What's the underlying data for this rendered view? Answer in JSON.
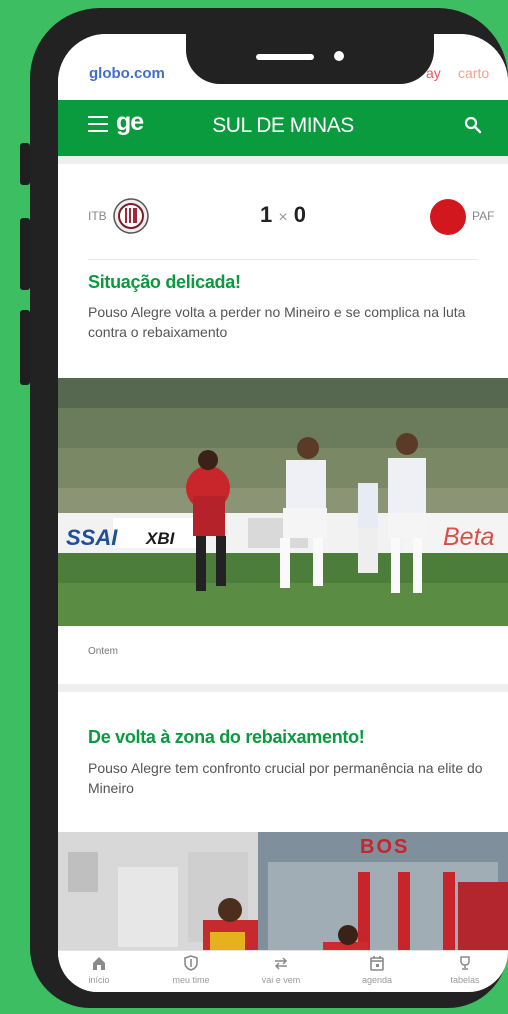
{
  "topbar": {
    "brand": "globo.com",
    "play": "ay",
    "cartola": "carto"
  },
  "header": {
    "logo": "ge",
    "section_title": "SUL DE MINAS"
  },
  "match": {
    "home_team": "ITB",
    "away_team": "PAF",
    "home_score": "1",
    "separator": "×",
    "away_score": "0"
  },
  "articles": [
    {
      "headline": "Situação delicada!",
      "summary": "Pouso Alegre volta a perder no Mineiro e se complica na luta contra o rebaixamento",
      "date": "Ontem",
      "banner_text_1": "SSAI",
      "banner_text_2": "XBI",
      "banner_text_3": "Beta"
    },
    {
      "headline": "De volta à zona do rebaixamento!",
      "summary": "Pouso Alegre tem confronto crucial por permanência na elite do Mineiro",
      "banner_text": "BOS"
    }
  ],
  "tabs": [
    {
      "label": "início",
      "icon": "home-icon"
    },
    {
      "label": "meu time",
      "icon": "shield-icon"
    },
    {
      "label": "vai e vem",
      "icon": "transfer-icon"
    },
    {
      "label": "agenda",
      "icon": "calendar-icon"
    },
    {
      "label": "tabelas",
      "icon": "trophy-icon"
    }
  ],
  "colors": {
    "background": "#3dbe63",
    "brand_green": "#0a9b3e",
    "headline_green": "#0a9b3e"
  }
}
